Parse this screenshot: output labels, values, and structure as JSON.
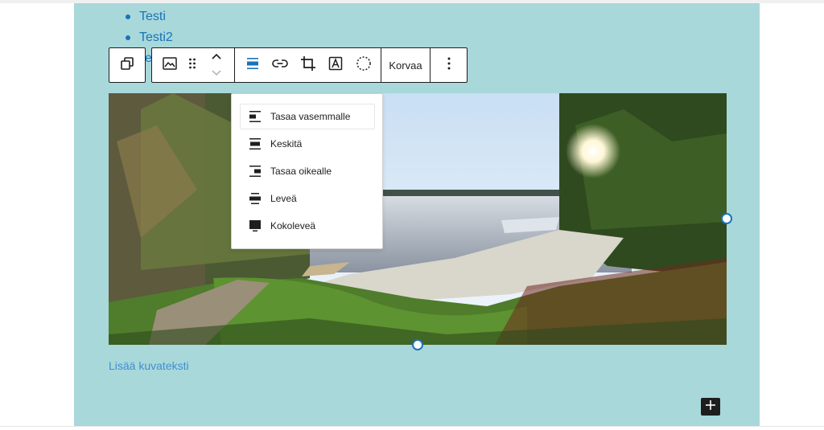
{
  "list": {
    "items": [
      {
        "label": "Testi"
      },
      {
        "label": "Testi2"
      }
    ],
    "partial_item": "e"
  },
  "toolbar": {
    "transform_icon": "block-transform-icon",
    "image_icon": "image-block-icon",
    "drag_icon": "drag-handle-icon",
    "move_up_icon": "chevron-up-icon",
    "move_down_icon": "chevron-down-icon",
    "align_icon": "align-none-icon",
    "link_icon": "link-icon",
    "crop_icon": "crop-icon",
    "text_overlay_icon": "text-overlay-icon",
    "duotone_icon": "duotone-circle-icon",
    "replace_label": "Korvaa",
    "more_icon": "more-vertical-icon"
  },
  "align_menu": {
    "items": [
      {
        "label": "Tasaa vasemmalle",
        "icon": "align-left-icon"
      },
      {
        "label": "Keskitä",
        "icon": "align-center-icon"
      },
      {
        "label": "Tasaa oikealle",
        "icon": "align-right-icon"
      },
      {
        "label": "Leveä",
        "icon": "align-wide-icon"
      },
      {
        "label": "Kokoleveä",
        "icon": "align-full-width-icon"
      }
    ]
  },
  "image": {
    "caption_placeholder": "Lisää kuvateksti"
  },
  "inserter": {
    "icon": "plus-icon"
  },
  "colors": {
    "canvas_bg": "#a8d8da",
    "accent": "#1a73b8",
    "dark": "#1e1e1e"
  }
}
